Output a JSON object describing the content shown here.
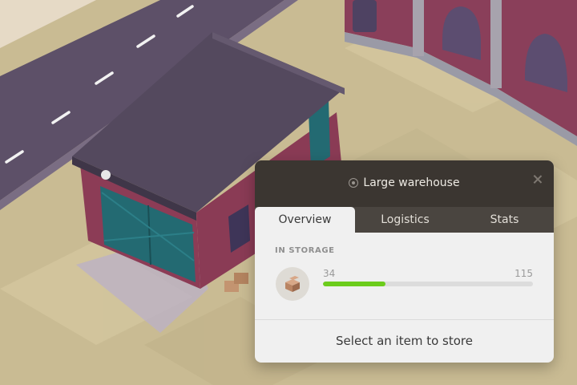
{
  "panel": {
    "title": "Large warehouse",
    "title_icon": "settings-badge-icon",
    "close_icon": "close-icon",
    "tabs": [
      {
        "label": "Overview",
        "active": true
      },
      {
        "label": "Logistics",
        "active": false
      },
      {
        "label": "Stats",
        "active": false
      }
    ],
    "storage": {
      "section_label": "IN STORAGE",
      "item_icon": "crate-icon",
      "current": "34",
      "capacity": "115",
      "fill_fraction": 0.296
    },
    "action_label": "Select an item to store"
  },
  "colors": {
    "header": "#3b3631",
    "tabs": "#4a4540",
    "progress": "#6ccc1c",
    "panel_body": "#f0f0f0"
  }
}
